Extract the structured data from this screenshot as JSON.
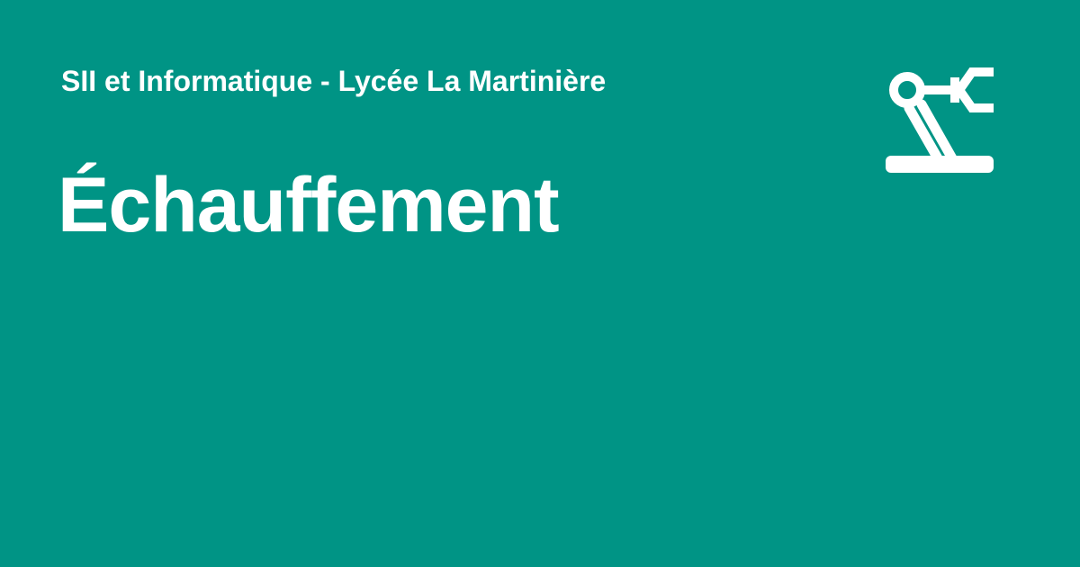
{
  "site": {
    "name": "SII et Informatique - Lycée La Martinière"
  },
  "page": {
    "title": "Échauffement"
  },
  "logo": {
    "icon": "robot-arm-icon"
  },
  "colors": {
    "background": "#009485",
    "foreground": "#ffffff"
  }
}
